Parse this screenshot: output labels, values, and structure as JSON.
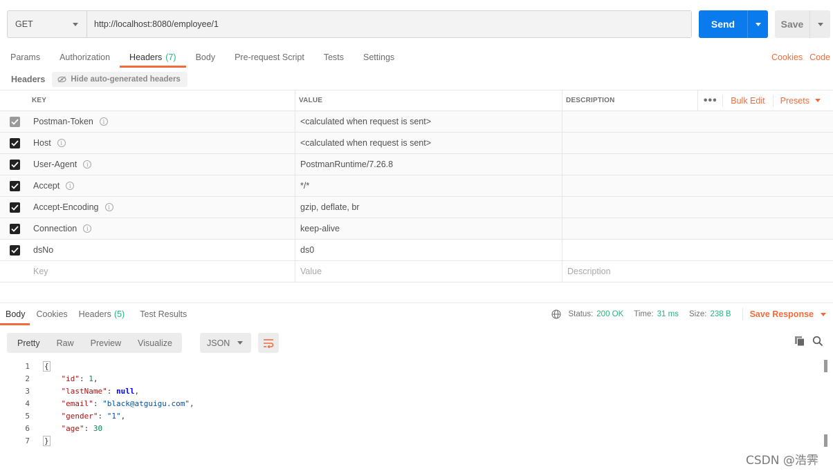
{
  "request": {
    "method": "GET",
    "url": "http://localhost:8080/employee/1",
    "send_label": "Send",
    "save_label": "Save"
  },
  "request_tabs": [
    {
      "label": "Params"
    },
    {
      "label": "Authorization"
    },
    {
      "label": "Headers",
      "count": "(7)",
      "active": true
    },
    {
      "label": "Body"
    },
    {
      "label": "Pre-request Script"
    },
    {
      "label": "Tests"
    },
    {
      "label": "Settings"
    }
  ],
  "request_right": {
    "cookies": "Cookies",
    "code": "Code"
  },
  "headers_bar": {
    "label": "Headers",
    "hide_button": "Hide auto-generated headers"
  },
  "table": {
    "col_key": "KEY",
    "col_value": "VALUE",
    "col_description": "DESCRIPTION",
    "more": "•••",
    "bulk_edit": "Bulk Edit",
    "presets": "Presets",
    "rows": [
      {
        "key": "Postman-Token",
        "value": "<calculated when request is sent>",
        "checked_style": "grey"
      },
      {
        "key": "Host",
        "value": "<calculated when request is sent>",
        "checked_style": "dark"
      },
      {
        "key": "User-Agent",
        "value": "PostmanRuntime/7.26.8",
        "checked_style": "dark"
      },
      {
        "key": "Accept",
        "value": "*/*",
        "checked_style": "dark"
      },
      {
        "key": "Accept-Encoding",
        "value": "gzip, deflate, br",
        "checked_style": "dark"
      },
      {
        "key": "Connection",
        "value": "keep-alive",
        "checked_style": "dark"
      },
      {
        "key": "dsNo",
        "value": "ds0",
        "checked_style": "dark",
        "no_info": true
      }
    ],
    "placeholder": {
      "key": "Key",
      "value": "Value",
      "description": "Description"
    }
  },
  "response_tabs": [
    {
      "label": "Body",
      "active": true
    },
    {
      "label": "Cookies"
    },
    {
      "label": "Headers",
      "count": "(5)"
    },
    {
      "label": "Test Results"
    }
  ],
  "status": {
    "status_label": "Status:",
    "status_value": "200 OK",
    "time_label": "Time:",
    "time_value": "31 ms",
    "size_label": "Size:",
    "size_value": "238 B",
    "save_response": "Save Response"
  },
  "view_modes": [
    "Pretty",
    "Raw",
    "Preview",
    "Visualize"
  ],
  "format": "JSON",
  "code_lines": [
    {
      "n": "1",
      "text": "{"
    },
    {
      "n": "2",
      "text": "    \"id\": 1,"
    },
    {
      "n": "3",
      "text": "    \"lastName\": null,"
    },
    {
      "n": "4",
      "text": "    \"email\": \"black@atguigu.com\","
    },
    {
      "n": "5",
      "text": "    \"gender\": \"1\","
    },
    {
      "n": "6",
      "text": "    \"age\": 30"
    },
    {
      "n": "7",
      "text": "}"
    }
  ],
  "watermark": "CSDN @浩霁",
  "colors": {
    "accent": "#f26b3a",
    "send": "#097bed",
    "ok": "#26b47f"
  },
  "icons": [
    "chevron-down-icon",
    "eye-off-icon",
    "info-icon",
    "checkbox-icon",
    "globe-icon",
    "wrap-lines-icon",
    "copy-icon",
    "search-icon"
  ]
}
